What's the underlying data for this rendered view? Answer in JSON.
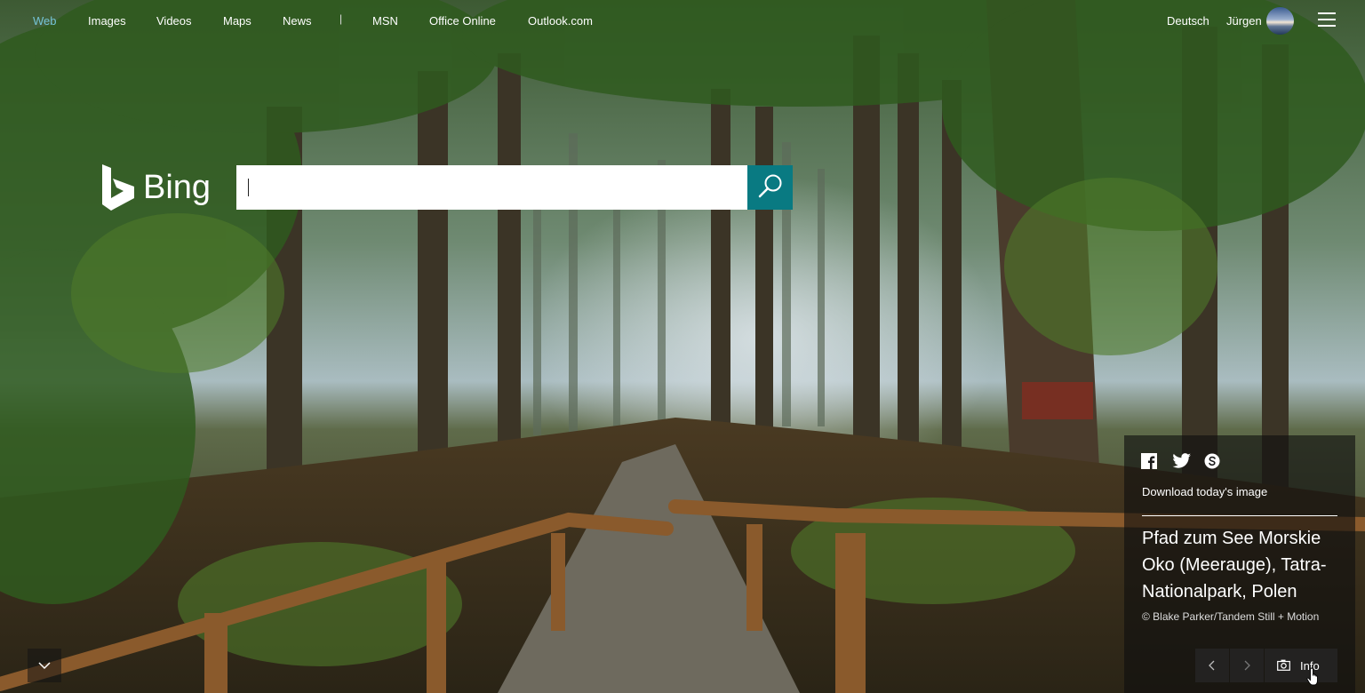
{
  "nav": {
    "items": [
      {
        "label": "Web",
        "active": true
      },
      {
        "label": "Images"
      },
      {
        "label": "Videos"
      },
      {
        "label": "Maps"
      },
      {
        "label": "News"
      },
      {
        "label": "MSN"
      },
      {
        "label": "Office Online"
      },
      {
        "label": "Outlook.com"
      }
    ],
    "separator": "|",
    "language": "Deutsch",
    "user_name": "Jürgen"
  },
  "logo": {
    "text": "Bing"
  },
  "search": {
    "value": "",
    "placeholder": ""
  },
  "info_panel": {
    "download_label": "Download today's image",
    "caption": "Pfad zum See Morskie Oko (Meerauge), Tatra-Nationalpark, Polen",
    "copyright": "© Blake Parker/Tandem Still + Motion",
    "info_label": "Info"
  },
  "colors": {
    "accent": "#097a82",
    "active_nav": "#74c3d6"
  }
}
